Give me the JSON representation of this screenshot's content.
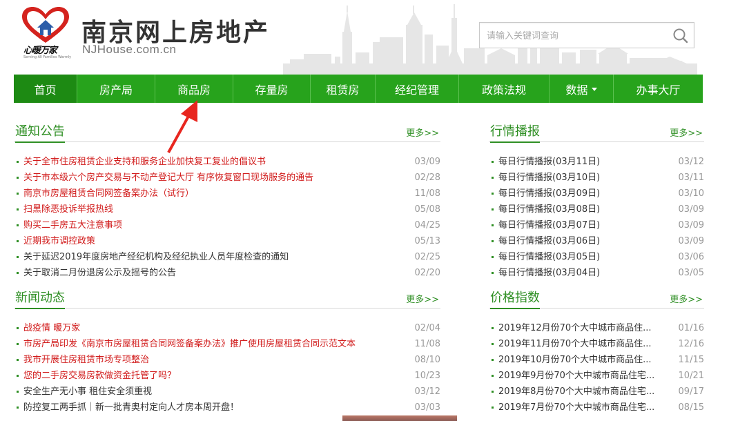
{
  "header": {
    "title": "南京网上房地产",
    "domain": "NJHouse.com.cn",
    "logo_text": "心暖万家",
    "logo_tagline": "Serving All Families Warmly"
  },
  "search": {
    "placeholder": "请输入关键词查询"
  },
  "nav": {
    "items": [
      "首页",
      "房产局",
      "商品房",
      "存量房",
      "租赁房",
      "经纪管理",
      "政策法规",
      "数据",
      "办事大厅"
    ]
  },
  "colors": {
    "brand_green": "#27a31c",
    "title_green": "#2f8f24",
    "link_red": "#d11a1a"
  },
  "more_label": "更多>>",
  "notices": {
    "title": "通知公告",
    "items": [
      {
        "text": "关于全市住房租赁企业支持和服务企业加快复工复业的倡议书",
        "date": "03/09",
        "style": "red"
      },
      {
        "text": "关于市本级六个房产交易与不动产登记大厅 有序恢复窗口现场服务的通告",
        "date": "02/28",
        "style": "red"
      },
      {
        "text": "南京市房屋租赁合同网签备案办法（试行）",
        "date": "11/08",
        "style": "red"
      },
      {
        "text": "扫黑除恶投诉举报热线",
        "date": "05/08",
        "style": "red"
      },
      {
        "text": "购买二手房五大注意事项",
        "date": "04/25",
        "style": "red"
      },
      {
        "text": "近期我市调控政策",
        "date": "05/13",
        "style": "red"
      },
      {
        "text": "关于延迟2019年度房地产经纪机构及经纪执业人员年度检查的通知",
        "date": "02/25",
        "style": "dark"
      },
      {
        "text": "关于取消二月份退房公示及摇号的公告",
        "date": "02/20",
        "style": "dark"
      }
    ]
  },
  "news": {
    "title": "新闻动态",
    "items": [
      {
        "text": "战疫情 暖万家",
        "date": "02/04",
        "style": "red"
      },
      {
        "text": "市房产局印发《南京市房屋租赁合同网签备案办法》推广使用房屋租赁合同示范文本",
        "date": "11/08",
        "style": "red"
      },
      {
        "text": "我市开展住房租赁市场专项整治",
        "date": "08/10",
        "style": "red"
      },
      {
        "text": "您的二手房交易房款做资金托管了吗？",
        "date": "10/23",
        "style": "red"
      },
      {
        "text": "安全生产无小事 租住安全须重视",
        "date": "03/12",
        "style": "dark"
      },
      {
        "text": "防控复工两手抓｜新一批青奥村定向人才房本周开盘！",
        "date": "03/03",
        "style": "dark"
      }
    ]
  },
  "market": {
    "title": "行情播报",
    "items": [
      {
        "text": "每日行情播报(03月11日)",
        "date": "03/12"
      },
      {
        "text": "每日行情播报(03月10日)",
        "date": "03/11"
      },
      {
        "text": "每日行情播报(03月09日)",
        "date": "03/10"
      },
      {
        "text": "每日行情播报(03月08日)",
        "date": "03/09"
      },
      {
        "text": "每日行情播报(03月07日)",
        "date": "03/09"
      },
      {
        "text": "每日行情播报(03月06日)",
        "date": "03/09"
      },
      {
        "text": "每日行情播报(03月05日)",
        "date": "03/06"
      },
      {
        "text": "每日行情播报(03月04日)",
        "date": "03/05"
      }
    ]
  },
  "price": {
    "title": "价格指数",
    "items": [
      {
        "text": "2019年12月份70个大中城市商品住...",
        "date": "01/16"
      },
      {
        "text": "2019年11月份70个大中城市商品住...",
        "date": "12/16"
      },
      {
        "text": "2019年10月份70个大中城市商品住...",
        "date": "11/15"
      },
      {
        "text": "2019年9月份70个大中城市商品住宅...",
        "date": "10/21"
      },
      {
        "text": "2019年8月份70个大中城市商品住宅...",
        "date": "09/17"
      },
      {
        "text": "2019年7月份70个大中城市商品住宅...",
        "date": "08/15"
      }
    ]
  }
}
